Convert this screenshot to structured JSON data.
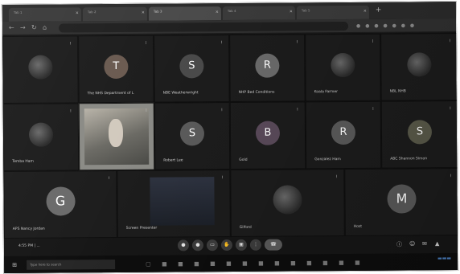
{
  "browser": {
    "tabs": [
      {
        "label": "Tab 1"
      },
      {
        "label": "Tab 2"
      },
      {
        "label": "Tab 3"
      },
      {
        "label": "Tab 4"
      },
      {
        "label": "Tab 5"
      }
    ],
    "address": ""
  },
  "participants": [
    {
      "name": "",
      "initial": "",
      "color": "#5a5a5a"
    },
    {
      "name": "The NHS Department of L",
      "initial": "T",
      "color": "#6a5a50"
    },
    {
      "name": "NBE Weatherwright",
      "initial": "S",
      "color": "#4a4a4a"
    },
    {
      "name": "NHP Bed Conditions",
      "initial": "R",
      "color": "#6a6a6a"
    },
    {
      "name": "Koala Farmer",
      "initial": "",
      "color": "#3a3a3a"
    },
    {
      "name": "NBL NHB",
      "initial": "",
      "color": "#5a5a5a"
    },
    {
      "name": "Temba Ham",
      "initial": "",
      "color": "#6a5a4a"
    },
    {
      "name": "",
      "initial": "",
      "color": "#8a8a85"
    },
    {
      "name": "Robert Lee",
      "initial": "S",
      "color": "#5a5a5a"
    },
    {
      "name": "Gold",
      "initial": "B",
      "color": "#5a4a5a"
    },
    {
      "name": "Gonzalez Ham",
      "initial": "R",
      "color": "#5a5a5a"
    },
    {
      "name": "ABC Shannon Simon",
      "initial": "S",
      "color": "#5a5a4a"
    },
    {
      "name": "APS Nancy Jordan",
      "initial": "G",
      "color": "#6a6a6a"
    },
    {
      "name": "Screen Presenter",
      "initial": "",
      "color": "#3a3a3a"
    },
    {
      "name": "Gilford",
      "initial": "",
      "color": "#8a8a8a"
    },
    {
      "name": "Host",
      "initial": "M",
      "color": "#5a5a5a"
    }
  ],
  "meeting": {
    "info": "4:55 PM | ..."
  },
  "taskbar": {
    "search_placeholder": "Type here to search"
  }
}
